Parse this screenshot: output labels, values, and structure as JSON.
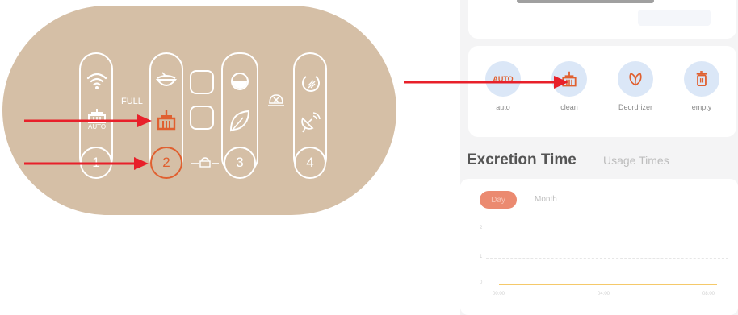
{
  "device": {
    "full_label": "FULL",
    "auto_label": "AUTO",
    "buttons": [
      "1",
      "2",
      "3",
      "4"
    ],
    "active_button": "2",
    "active_color": "#e06030",
    "panel_color": "#d5bfa6"
  },
  "app": {
    "modes": [
      {
        "icon_text": "AUTO",
        "label": "auto",
        "icon": "auto-icon"
      },
      {
        "label": "clean",
        "icon": "broom-icon"
      },
      {
        "label": "Deordrizer",
        "icon": "leaf-icon"
      },
      {
        "label": "empty",
        "icon": "trash-icon"
      }
    ],
    "tabs": {
      "excretion": "Excretion Time",
      "usage": "Usage Times"
    },
    "periods": {
      "day": "Day",
      "month": "Month"
    },
    "chart_ticks": {
      "y": [
        "2",
        "1",
        "0"
      ],
      "x": [
        "00:00",
        "04:00",
        "08:00"
      ]
    }
  },
  "colors": {
    "arrow": "#e8202a",
    "mode_bg": "#dbe7f7",
    "line": "#f5c96a"
  }
}
